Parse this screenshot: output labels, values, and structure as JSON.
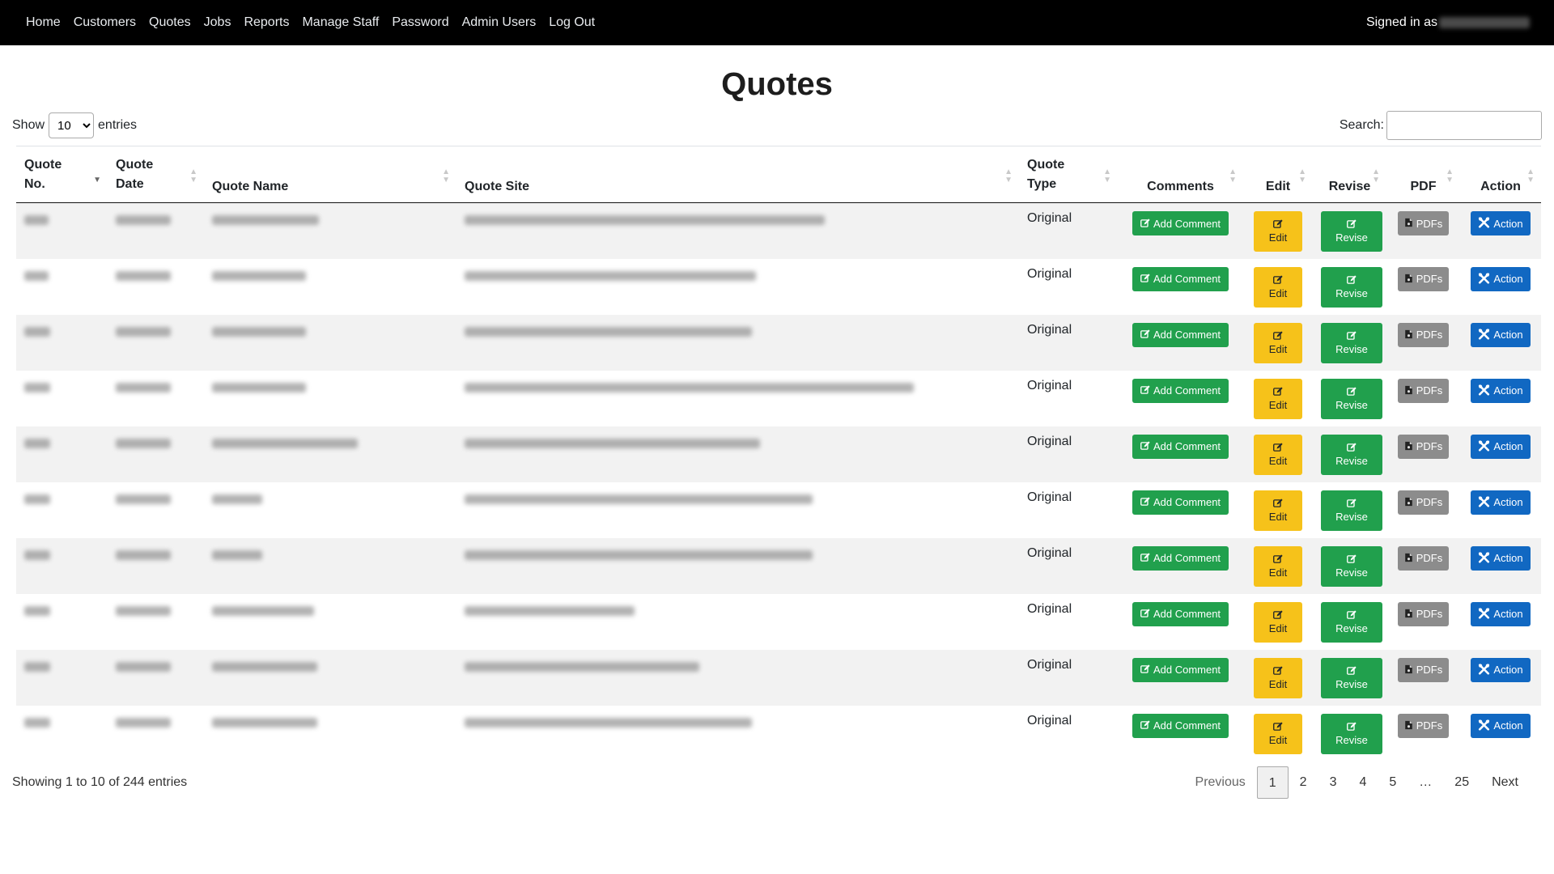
{
  "nav": {
    "links": [
      "Home",
      "Customers",
      "Quotes",
      "Jobs",
      "Reports",
      "Manage Staff",
      "Password",
      "Admin Users",
      "Log Out"
    ],
    "signed_in_label": "Signed in as"
  },
  "page": {
    "title": "Quotes"
  },
  "length": {
    "show_label": "Show",
    "value": "10",
    "entries_label": "entries"
  },
  "search": {
    "label": "Search:",
    "value": ""
  },
  "table": {
    "columns": [
      "Quote No.",
      "Quote Date",
      "Quote Name",
      "Quote Site",
      "Quote Type",
      "Comments",
      "Edit",
      "Revise",
      "PDF",
      "Action"
    ],
    "sorted_column": "Quote No.",
    "sort_direction": "descending",
    "rows": [
      {
        "quote_type": "Original"
      },
      {
        "quote_type": "Original"
      },
      {
        "quote_type": "Original"
      },
      {
        "quote_type": "Original"
      },
      {
        "quote_type": "Original"
      },
      {
        "quote_type": "Original"
      },
      {
        "quote_type": "Original"
      },
      {
        "quote_type": "Original"
      },
      {
        "quote_type": "Original"
      },
      {
        "quote_type": "Original"
      }
    ],
    "buttons": {
      "add_comment": "Add Comment",
      "edit": "Edit",
      "revise": "Revise",
      "pdfs": "PDFs",
      "action": "Action"
    }
  },
  "footer": {
    "info": "Showing 1 to 10 of 244 entries",
    "pagination": [
      "Previous",
      "1",
      "2",
      "3",
      "4",
      "5",
      "…",
      "25",
      "Next"
    ],
    "current_page": "1"
  },
  "colors": {
    "navbar": "#000000",
    "add_comment": "#21a04d",
    "edit": "#f6c21a",
    "revise": "#21a04d",
    "pdfs": "#8c8c8c",
    "action": "#1168c2",
    "stripe": "#f2f2f2"
  },
  "icons": {
    "add_comment": "pencil-square-icon",
    "edit": "pencil-square-icon",
    "revise": "pencil-square-icon",
    "pdfs": "file-pdf-icon",
    "action": "tools-icon"
  }
}
